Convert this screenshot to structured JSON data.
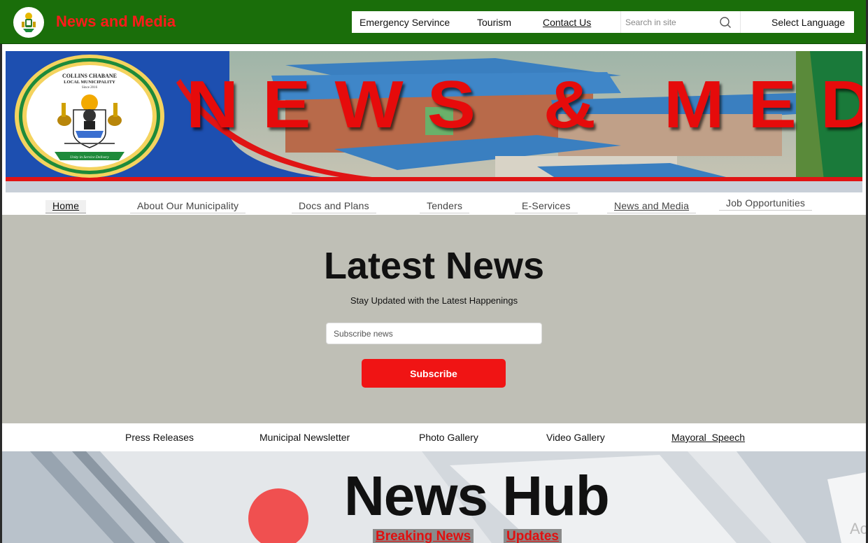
{
  "header": {
    "site_title": "News and Media",
    "nav": {
      "emergency": "Emergency Servince",
      "tourism": "Tourism",
      "contact": "Contact Us"
    },
    "search": {
      "placeholder": "Search in site"
    },
    "language": "Select Language"
  },
  "banner": {
    "headline": "NEWS & MEDIA",
    "seal_name_line1": "COLLINS CHABANE",
    "seal_name_line2": "LOCAL MUNICIPALITY",
    "seal_since": "Since 2016",
    "seal_motto": "Unity in Service Delivery"
  },
  "main_nav": [
    "Home",
    "About Our Municipality",
    "Docs and Plans",
    "Tenders",
    "E-Services",
    "News and Media",
    "Job Opportunities"
  ],
  "latest": {
    "title": "Latest News",
    "subtitle": "Stay Updated with the Latest Happenings",
    "input_placeholder": "Subscribe news",
    "button": "Subscribe"
  },
  "sub_nav": [
    "Press Releases",
    "Municipal Newsletter",
    "Photo Gallery",
    "Video Gallery",
    "Mayoral  Speech"
  ],
  "hub": {
    "title": "News Hub",
    "tag_breaking": "Breaking News",
    "tag_updates": "Updates",
    "corner_text": "Ac"
  },
  "colors": {
    "header_green": "#1a6e0a",
    "title_red": "#ff1a1a",
    "banner_blue": "#1d4fb0",
    "subscribe_red": "#f01414",
    "latest_bg": "#bfbfb6"
  }
}
